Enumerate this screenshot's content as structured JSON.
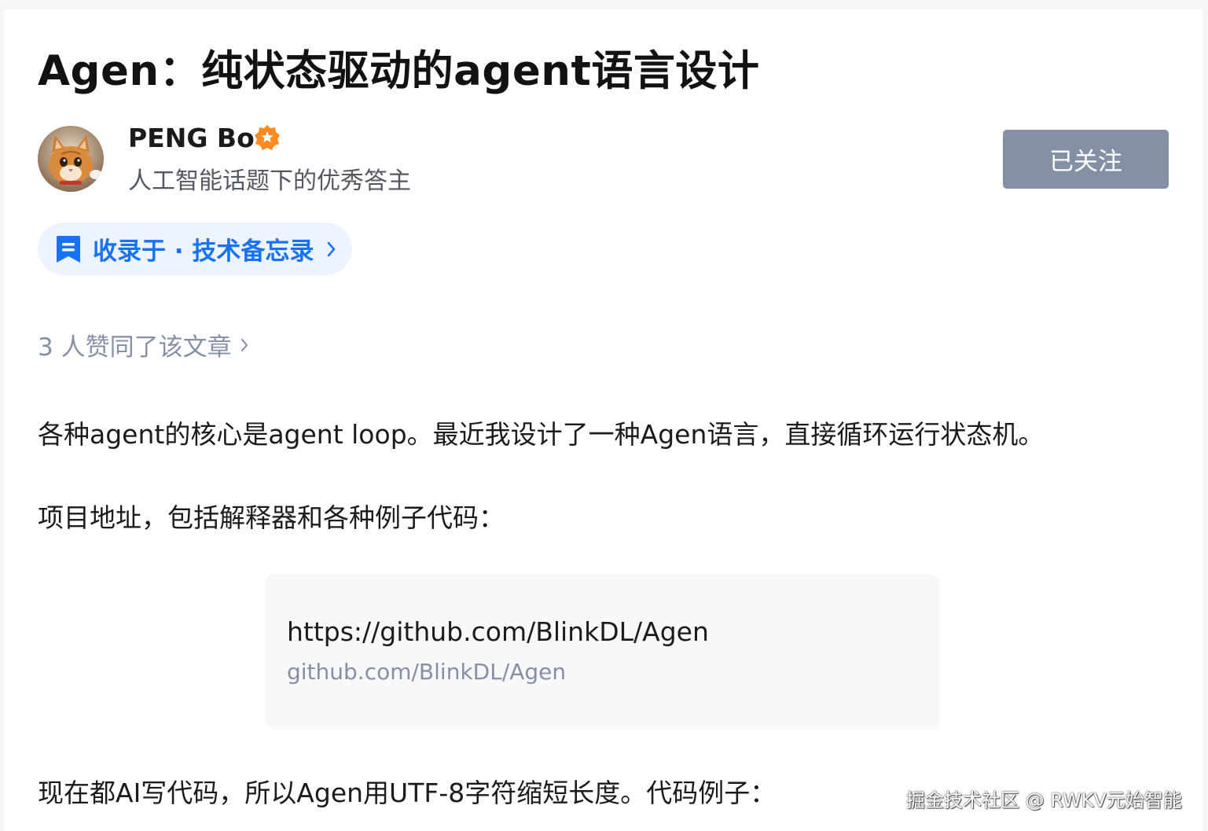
{
  "article": {
    "title": "Agen：纯状态驱动的agent语言设计"
  },
  "author": {
    "name": "PENG Bo",
    "description": "人工智能话题下的优秀答主",
    "follow_label": "已关注"
  },
  "collection": {
    "label": "收录于 · 技术备忘录"
  },
  "likes": {
    "text": "3 人赞同了该文章"
  },
  "body": {
    "paragraph_1": "各种agent的核心是agent loop。最近我设计了一种Agen语言，直接循环运行状态机。",
    "paragraph_2": "项目地址，包括解释器和各种例子代码：",
    "link_card": {
      "title": "https://github.com/BlinkDL/Agen",
      "url": "github.com/BlinkDL/Agen"
    },
    "paragraph_3": "现在都AI写代码，所以Agen用UTF-8字符缩短长度。代码例子："
  },
  "watermark": "掘金技术社区 @ RWKV元始智能",
  "colors": {
    "accent_blue": "#1772f6",
    "follow_button_bg": "#8491a5",
    "badge_orange": "#ff8a1f",
    "pill_bg": "#eef4ff"
  },
  "icons": {
    "badge": "verified-badge-icon",
    "bookmark": "bookmark-icon",
    "chevron": "chevron-right-icon"
  }
}
